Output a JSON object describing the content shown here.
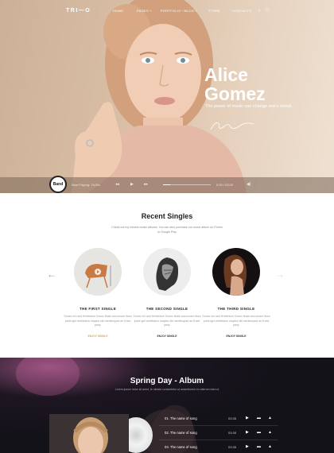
{
  "nav": {
    "logo": "TRI—O",
    "items": [
      "HOME",
      "PAGES +",
      "PORTFOLIO +",
      "BLOG +",
      "STORE",
      "CONTACTS"
    ],
    "icons": [
      "search-icon",
      "cart-icon"
    ]
  },
  "hero": {
    "name_line1": "Alice",
    "name_line2": "Gomez",
    "tagline": "The power of music can change one's mood.",
    "signature": "signature"
  },
  "player": {
    "badge": "Band",
    "now_playing": "Now Playing: Tri-Mo",
    "time": "0:00 / 03:20",
    "progress": 0.15
  },
  "singles": {
    "title": "Recent Singles",
    "subtitle": "Check out my newest music albums. You can also purchase our music album on",
    "stores": "iTunes or Google Play",
    "items": [
      {
        "title": "THE FIRST SINGLE",
        "text": "Donec sit t sed fermentum Donec finale and ornare litora porta iget vestibulum naqdos ollo isentesques an ft sed party.",
        "cta": "ENJOY SINGLE"
      },
      {
        "title": "THE SECOND SINGLE",
        "text": "Donec sit t sed fermentum Donec finale and ornare litora porta iget vestibulum naqdos ollo isentesques an ft sed party.",
        "cta": "ENJOY SINGLE"
      },
      {
        "title": "THE THIRD SINGLE",
        "text": "Donec sit t sed fermentum Donec finale and ornare litora porta iget vestibulum naqdos ollo isentesques an ft sed party.",
        "cta": "ENJOY SINGLE"
      }
    ]
  },
  "album": {
    "title": "Spring Day - Album",
    "subtitle": "Lorem ipsum dolor sit amet, te dictata consectetur ut assentiorem eu alterum eam ut",
    "tracks": [
      {
        "name": "01. The name of song",
        "duration": "03:35"
      },
      {
        "name": "02. The name of song",
        "duration": "03:35"
      },
      {
        "name": "03. The name of song",
        "duration": "03:35"
      }
    ]
  },
  "colors": {
    "accent": "#e2a24a",
    "hero_bg": "#d9bfa6",
    "album_bg": "#16141b"
  }
}
